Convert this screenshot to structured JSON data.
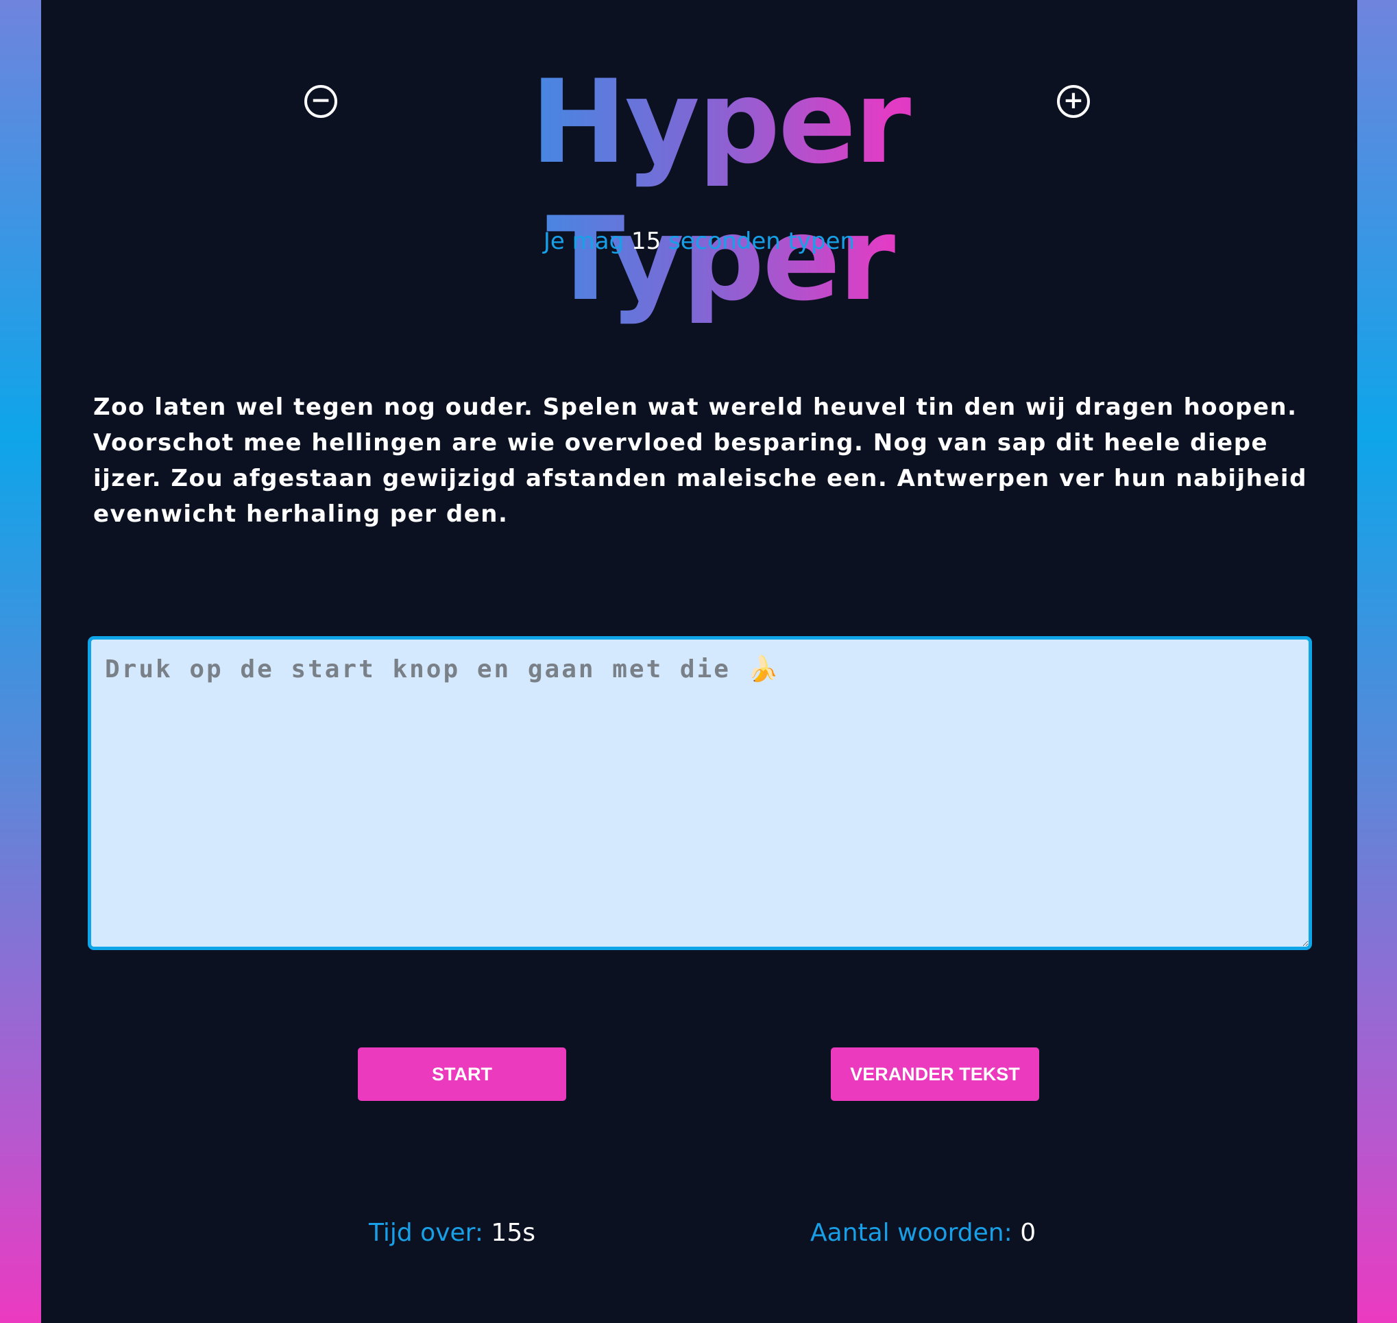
{
  "header": {
    "title": "Hyper Typer",
    "decrease_icon": "minus-circle-icon",
    "increase_icon": "plus-circle-icon",
    "decrease_symbol": "−",
    "increase_symbol": "+"
  },
  "subtitle": {
    "prefix": "Je mag",
    "seconds": "15",
    "suffix": "seconden typen"
  },
  "passage": {
    "text": "Zoo laten wel tegen nog ouder. Spelen wat wereld heuvel tin den wij dragen hoopen. Voorschot mee hellingen are wie overvloed besparing. Nog van sap dit heele diepe ijzer. Zou afgestaan gewijzigd afstanden maleische een. Antwerpen ver hun nabijheid evenwicht herhaling per den."
  },
  "input": {
    "placeholder": "Druk op de start knop en gaan met die 🍌",
    "value": ""
  },
  "buttons": {
    "start_label": "START",
    "change_label": "VERANDER TEKST"
  },
  "stats": {
    "time_label": "Tijd over:",
    "time_value": "15s",
    "words_label": "Aantal woorden:",
    "words_value": "0"
  },
  "colors": {
    "panel_bg": "#0c1122",
    "accent_blue": "#17a0e8",
    "accent_pink": "#eb3abe",
    "input_bg": "#d4e9fd",
    "input_border": "#0ea5e9"
  }
}
